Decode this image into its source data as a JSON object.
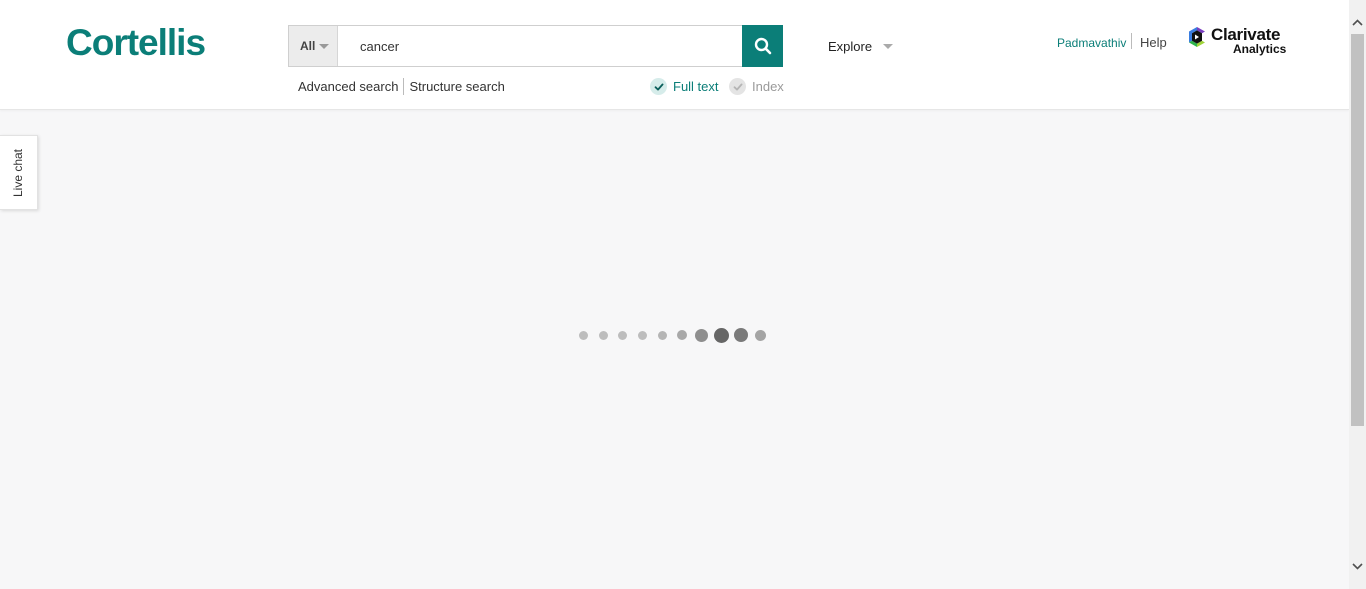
{
  "brand": {
    "logo": "Cortellis",
    "accent": "#0b7e78"
  },
  "search": {
    "scope_label": "All",
    "query": "cancer",
    "button_icon": "search-icon"
  },
  "links": {
    "advanced": "Advanced search",
    "structure": "Structure search"
  },
  "toggles": {
    "full_text": "Full text",
    "full_text_checked": true,
    "index": "Index",
    "index_checked": false
  },
  "nav": {
    "explore": "Explore"
  },
  "user": {
    "name": "Padmavathiv",
    "help": "Help"
  },
  "partner": {
    "name": "Clarivate",
    "sub": "Analytics"
  },
  "livechat": {
    "label": "Live chat"
  },
  "loader": {
    "dot_count": 10,
    "state": "loading"
  }
}
